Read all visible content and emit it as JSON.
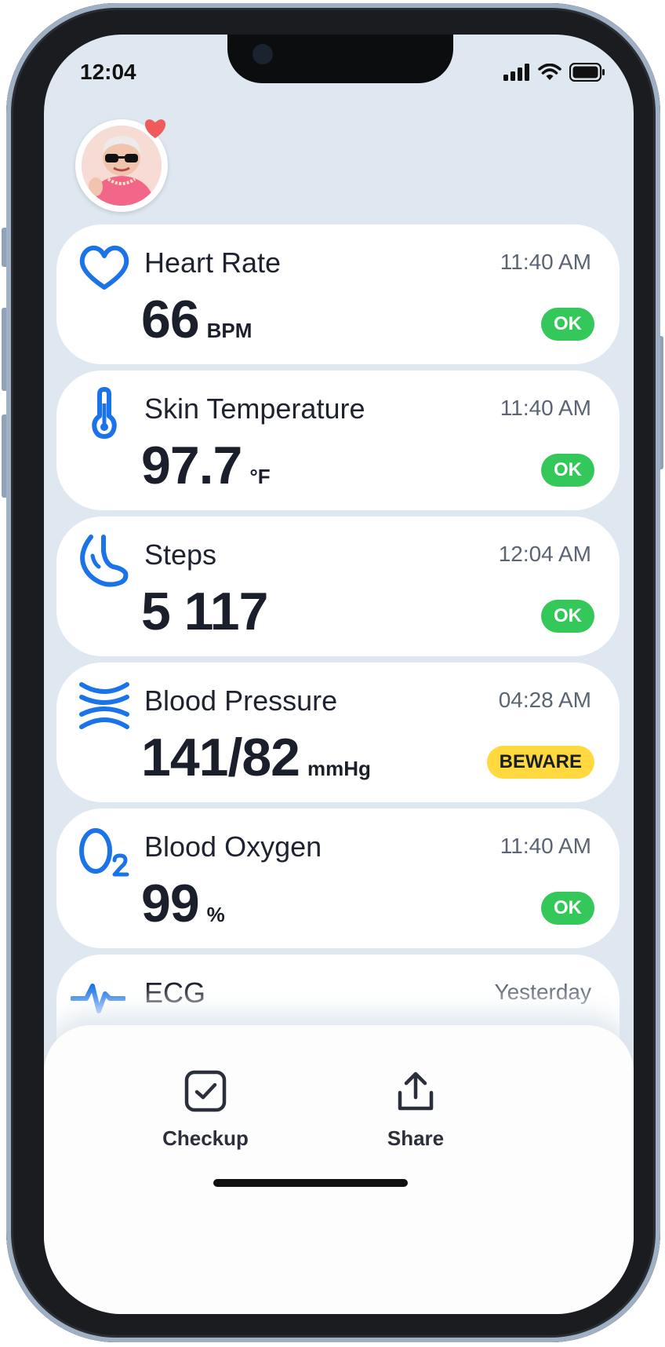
{
  "status_bar": {
    "time": "12:04"
  },
  "metrics": [
    {
      "name": "heart-rate",
      "title": "Heart Rate",
      "time": "11:40 AM",
      "value": "66",
      "unit": "BPM",
      "status": "OK",
      "icon": "heart-icon"
    },
    {
      "name": "skin-temperature",
      "title": "Skin Temperature",
      "time": "11:40 AM",
      "value": "97.7",
      "unit": "°F",
      "status": "OK",
      "icon": "thermometer-icon"
    },
    {
      "name": "steps",
      "title": "Steps",
      "time": "12:04 AM",
      "value": "5 117",
      "unit": "",
      "status": "OK",
      "icon": "foot-icon"
    },
    {
      "name": "blood-pressure",
      "title": "Blood Pressure",
      "time": "04:28 AM",
      "value": "141/82",
      "unit": "mmHg",
      "status": "BEWARE",
      "icon": "blood-pressure-icon"
    },
    {
      "name": "blood-oxygen",
      "title": "Blood Oxygen",
      "time": "11:40 AM",
      "value": "99",
      "unit": "%",
      "status": "OK",
      "icon": "o2-icon"
    },
    {
      "name": "ecg",
      "title": "ECG",
      "time": "Yesterday",
      "value": "",
      "unit": "",
      "status": "",
      "icon": "ecg-icon"
    }
  ],
  "bottom_nav": {
    "checkup_label": "Checkup",
    "share_label": "Share"
  },
  "colors": {
    "accent": "#1a73e8",
    "ok": "#34c759",
    "beware": "#ffd93d"
  }
}
